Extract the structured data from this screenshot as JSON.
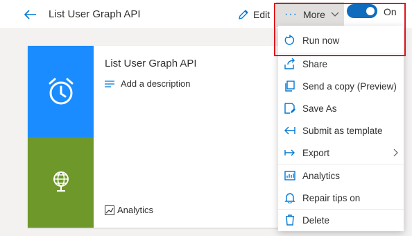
{
  "header": {
    "title": "List User Graph API",
    "edit_label": "Edit",
    "more_label": "More",
    "toggle_label": "On"
  },
  "card": {
    "title": "List User Graph API",
    "add_description": "Add a description",
    "analytics_label": "Analytics"
  },
  "menu": {
    "items": [
      {
        "label": "Run now",
        "icon": "run-icon"
      },
      {
        "label": "Share",
        "icon": "share-icon"
      },
      {
        "label": "Send a copy (Preview)",
        "icon": "copy-icon"
      },
      {
        "label": "Save As",
        "icon": "save-as-icon"
      },
      {
        "label": "Submit as template",
        "icon": "submit-icon"
      },
      {
        "label": "Export",
        "icon": "export-icon"
      },
      {
        "label": "Analytics",
        "icon": "analytics-icon"
      },
      {
        "label": "Repair tips on",
        "icon": "bell-icon"
      },
      {
        "label": "Delete",
        "icon": "delete-icon"
      }
    ]
  },
  "colors": {
    "accent": "#0078d4",
    "trigger_tile": "#1a8cff",
    "action_tile": "#6f982b",
    "highlight_border": "#e1141b"
  }
}
